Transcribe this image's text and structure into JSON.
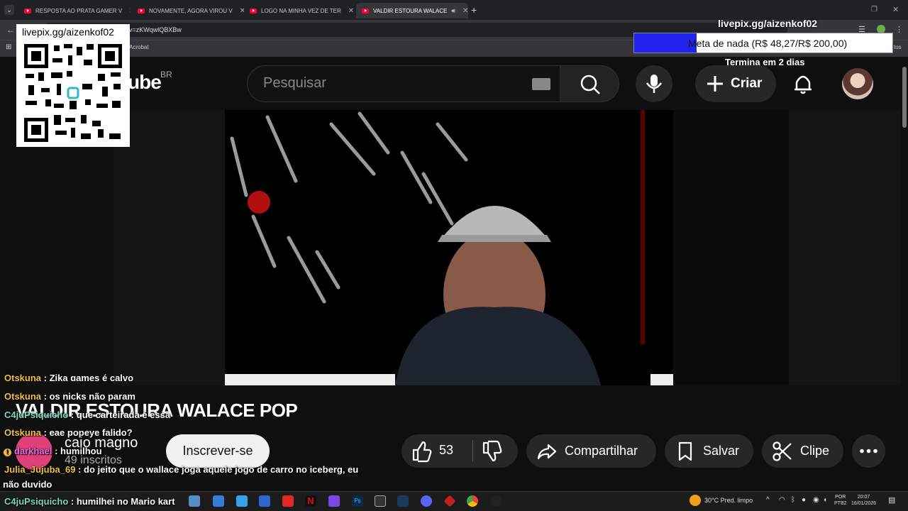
{
  "browser": {
    "tabs": [
      {
        "label": "RESPOSTA AO PRATA GAMER V",
        "active": false
      },
      {
        "label": "NOVAMENTE, AGORA VIROU V",
        "active": false
      },
      {
        "label": "LOGO NA MINHA VEZ DE TER",
        "active": false
      },
      {
        "label": "VALDIR ESTOURA WALACE",
        "active": true
      }
    ],
    "new_tab_label": "+",
    "url_fragment": "h?v=zKWqwlQBXBw",
    "bookmark_fragment": "Acrobat",
    "bookmark_right": "tos"
  },
  "youtube": {
    "logo_tail": "ube",
    "region": "BR",
    "search_placeholder": "Pesquisar",
    "create_label": "Criar",
    "video_title": "VALDIR ESTOURA WALACE POP",
    "channel_name": "caio magno",
    "subscribers": "49 inscritos",
    "subscribe_label": "Inscrever-se",
    "like_count": "53",
    "share_label": "Compartilhar",
    "save_label": "Salvar",
    "clip_label": "Clipe"
  },
  "overlay": {
    "qr_title": "livepix.gg/aizenkof02",
    "goal_url": "livepix.gg/aizenkof02",
    "goal_text": "Meta de nada (R$ 48,27/R$ 200,00)",
    "goal_progress": 0.2414,
    "goal_ends": "Termina em 2 dias"
  },
  "chat": [
    {
      "user": "Otskuna",
      "sep": " : ",
      "msg": "Zika games é calvo",
      "user_color": "yellow"
    },
    {
      "user": "Otskuna",
      "sep": " : ",
      "msg": "os nicks não param",
      "user_color": "yellow"
    },
    {
      "user": "C4juPsiquicho",
      "sep": " : ",
      "msg": "que carteirada é essa",
      "user_color": "green"
    },
    {
      "user": "Otskuna",
      "sep": " : ",
      "msg": "eae popeye falido?",
      "user_color": "yellow"
    },
    {
      "user": "darkhael",
      "sep": " : ",
      "msg": "humilhou",
      "user_color": "purple"
    },
    {
      "user": "Julia_Jujuba_69",
      "sep": " : ",
      "msg": "do jeito que o wallace joga aquele jogo de carro no iceberg, eu",
      "user_color": "yellow"
    },
    {
      "user": "",
      "sep": "",
      "msg": "não duvido",
      "user_color": "yellow"
    },
    {
      "user": "C4juPsiquicho",
      "sep": " : ",
      "msg": "humilhei no Mario kart",
      "user_color": "green"
    }
  ],
  "taskbar": {
    "weather": "30°C  Pred. limpo",
    "lang_1": "POR",
    "lang_2": "PTB2",
    "time": "20:07",
    "date": "16/01/2026"
  },
  "colors": {
    "yt_red": "#ff0033",
    "goal_fill": "#2222ee",
    "chat_user_yellow": "#f0c040",
    "chat_user_green": "#7ad6c4",
    "chat_user_purple": "#e070e0"
  }
}
